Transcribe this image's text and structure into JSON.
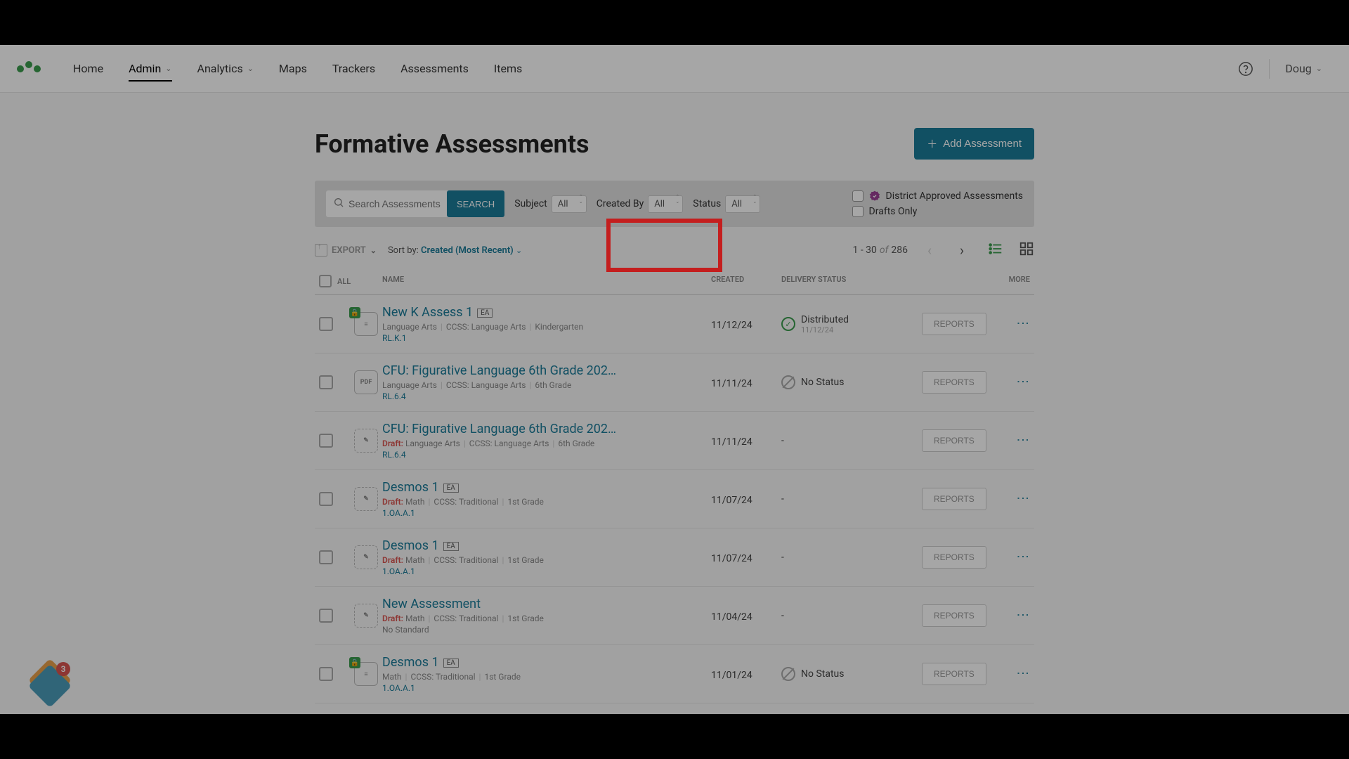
{
  "nav": {
    "items": [
      "Home",
      "Admin",
      "Analytics",
      "Maps",
      "Trackers",
      "Assessments",
      "Items"
    ],
    "active": "Admin",
    "user": "Doug"
  },
  "page": {
    "title": "Formative Assessments",
    "add_button": "Add Assessment"
  },
  "filters": {
    "search_placeholder": "Search Assessments",
    "search_button": "SEARCH",
    "subject_label": "Subject",
    "subject_value": "All",
    "createdby_label": "Created By",
    "createdby_value": "All",
    "status_label": "Status",
    "status_value": "All",
    "district_approved": "District Approved Assessments",
    "drafts_only": "Drafts Only"
  },
  "toolbar": {
    "export": "EXPORT",
    "sort_label": "Sort by:",
    "sort_value": "Created (Most Recent)",
    "pager_range": "1 - 30",
    "pager_of": "of",
    "pager_total": "286"
  },
  "columns": {
    "all": "ALL",
    "name": "NAME",
    "created": "CREATED",
    "delivery": "DELIVERY STATUS",
    "more": "MORE"
  },
  "rows": [
    {
      "title": "New K Assess 1",
      "ea": "EA",
      "draft": false,
      "locked": true,
      "icon_type": "ITEM",
      "meta": "Language Arts | CCSS: Language Arts | Kindergarten",
      "standard": "RL.K.1",
      "created": "11/12/24",
      "delivery_status": "Distributed",
      "delivery_sub": "11/12/24",
      "delivery_icon": "ok",
      "reports": "REPORTS"
    },
    {
      "title": "CFU: Figurative Language 6th Grade 202…",
      "ea": "",
      "draft": false,
      "locked": false,
      "icon_type": "PDF",
      "meta": "Language Arts | CCSS: Language Arts | 6th Grade",
      "standard": "RL.6.4",
      "created": "11/11/24",
      "delivery_status": "No Status",
      "delivery_sub": "",
      "delivery_icon": "none",
      "reports": "REPORTS"
    },
    {
      "title": "CFU: Figurative Language 6th Grade 202…",
      "ea": "",
      "draft": true,
      "locked": false,
      "icon_type": "DRAFT",
      "meta": "Language Arts | CCSS: Language Arts | 6th Grade",
      "standard": "RL.6.4",
      "created": "11/11/24",
      "delivery_status": "-",
      "delivery_sub": "",
      "delivery_icon": "",
      "reports": "REPORTS"
    },
    {
      "title": "Desmos 1",
      "ea": "EA",
      "draft": true,
      "locked": false,
      "icon_type": "DRAFT",
      "meta": "Math | CCSS: Traditional | 1st Grade",
      "standard": "1.OA.A.1",
      "created": "11/07/24",
      "delivery_status": "-",
      "delivery_sub": "",
      "delivery_icon": "",
      "reports": "REPORTS"
    },
    {
      "title": "Desmos 1",
      "ea": "EA",
      "draft": true,
      "locked": false,
      "icon_type": "DRAFT",
      "meta": "Math | CCSS: Traditional | 1st Grade",
      "standard": "1.OA.A.1",
      "created": "11/07/24",
      "delivery_status": "-",
      "delivery_sub": "",
      "delivery_icon": "",
      "reports": "REPORTS"
    },
    {
      "title": "New Assessment",
      "ea": "",
      "draft": true,
      "locked": false,
      "icon_type": "DRAFT",
      "meta": "Math | CCSS: Traditional | 1st Grade",
      "standard": "No Standard",
      "standard_none": true,
      "created": "11/04/24",
      "delivery_status": "-",
      "delivery_sub": "",
      "delivery_icon": "",
      "reports": "REPORTS"
    },
    {
      "title": "Desmos 1",
      "ea": "EA",
      "draft": false,
      "locked": true,
      "icon_type": "ITEM",
      "meta": "Math | CCSS: Traditional | 1st Grade",
      "standard": "1.OA.A.1",
      "created": "11/01/24",
      "delivery_status": "No Status",
      "delivery_sub": "",
      "delivery_icon": "none",
      "reports": "REPORTS"
    }
  ],
  "float": {
    "count": "3"
  }
}
